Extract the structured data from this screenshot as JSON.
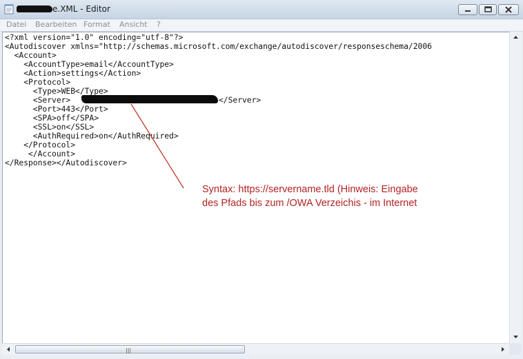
{
  "window": {
    "title_suffix": "e.XML - Editor"
  },
  "menu": {
    "items": [
      "Datei",
      "Bearbeiten",
      "Format",
      "Ansicht",
      "?"
    ]
  },
  "editor": {
    "lines": [
      "<?xml version=\"1.0\" encoding=\"utf-8\"?>",
      "<Autodiscover xmlns=\"http://schemas.microsoft.com/exchange/autodiscover/responseschema/2006",
      "  <Account>",
      "    <AccountType>email</AccountType>",
      "    <Action>settings</Action>",
      "    <Protocol>",
      "      <Type>WEB</Type>",
      "      <Server>",
      "      <Port>443</Port>",
      "      <SPA>off</SPA>",
      "      <SSL>on</SSL>",
      "      <AuthRequired>on</AuthRequired>",
      "    </Protocol>",
      "     </Account>",
      "</Response></Autodiscover>"
    ],
    "server_close_tag": "</Server>"
  },
  "annotation": {
    "line1": "Syntax: https://servername.tld (Hinweis: Eingabe",
    "line2": "des Pfads bis zum /OWA Verzeichis - im Internet",
    "color": "#b22222"
  },
  "icons": {
    "app": "notepad-icon",
    "minimize": "minimize-icon",
    "maximize": "maximize-icon",
    "close": "close-icon",
    "scroll_up": "arrow-up-icon",
    "scroll_down": "arrow-down-icon",
    "scroll_left": "arrow-left-icon",
    "scroll_right": "arrow-right-icon"
  }
}
